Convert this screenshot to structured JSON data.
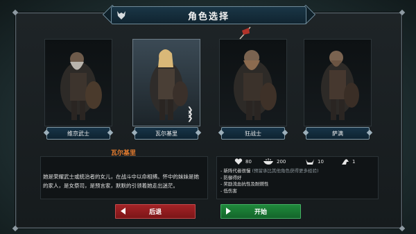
{
  "header": {
    "title": "角色选择",
    "crest_icon": "wolf-crest-icon"
  },
  "characters": [
    {
      "name": "维京武士",
      "selected": false
    },
    {
      "name": "瓦尔基里",
      "selected": true
    },
    {
      "name": "狂战士",
      "selected": false
    },
    {
      "name": "萨满",
      "selected": false
    }
  ],
  "description": {
    "title": "瓦尔基里",
    "text": "她是荣耀武士或统治者的女儿，在战斗中以命相搏。怀中的妹妹是她的家人，是女祭司，是预言家，默默的引领着她走出迷茫。"
  },
  "stats": {
    "health": "80",
    "food": "200",
    "horns": "10",
    "strength": "1"
  },
  "traits": {
    "t1": "- 新阵代者很慢",
    "t1_hint": "(预留承比其他角色获得更多经验)",
    "t2": "- 防御得好",
    "t3": "- 奖励流血抗性及耐燃性",
    "t4": "- 低伤害"
  },
  "buttons": {
    "back": "后退",
    "start": "开始"
  },
  "colors": {
    "accent_title": "#e07a2e",
    "back": "#a32326",
    "start": "#1f8a3b",
    "plate": "#173447"
  }
}
